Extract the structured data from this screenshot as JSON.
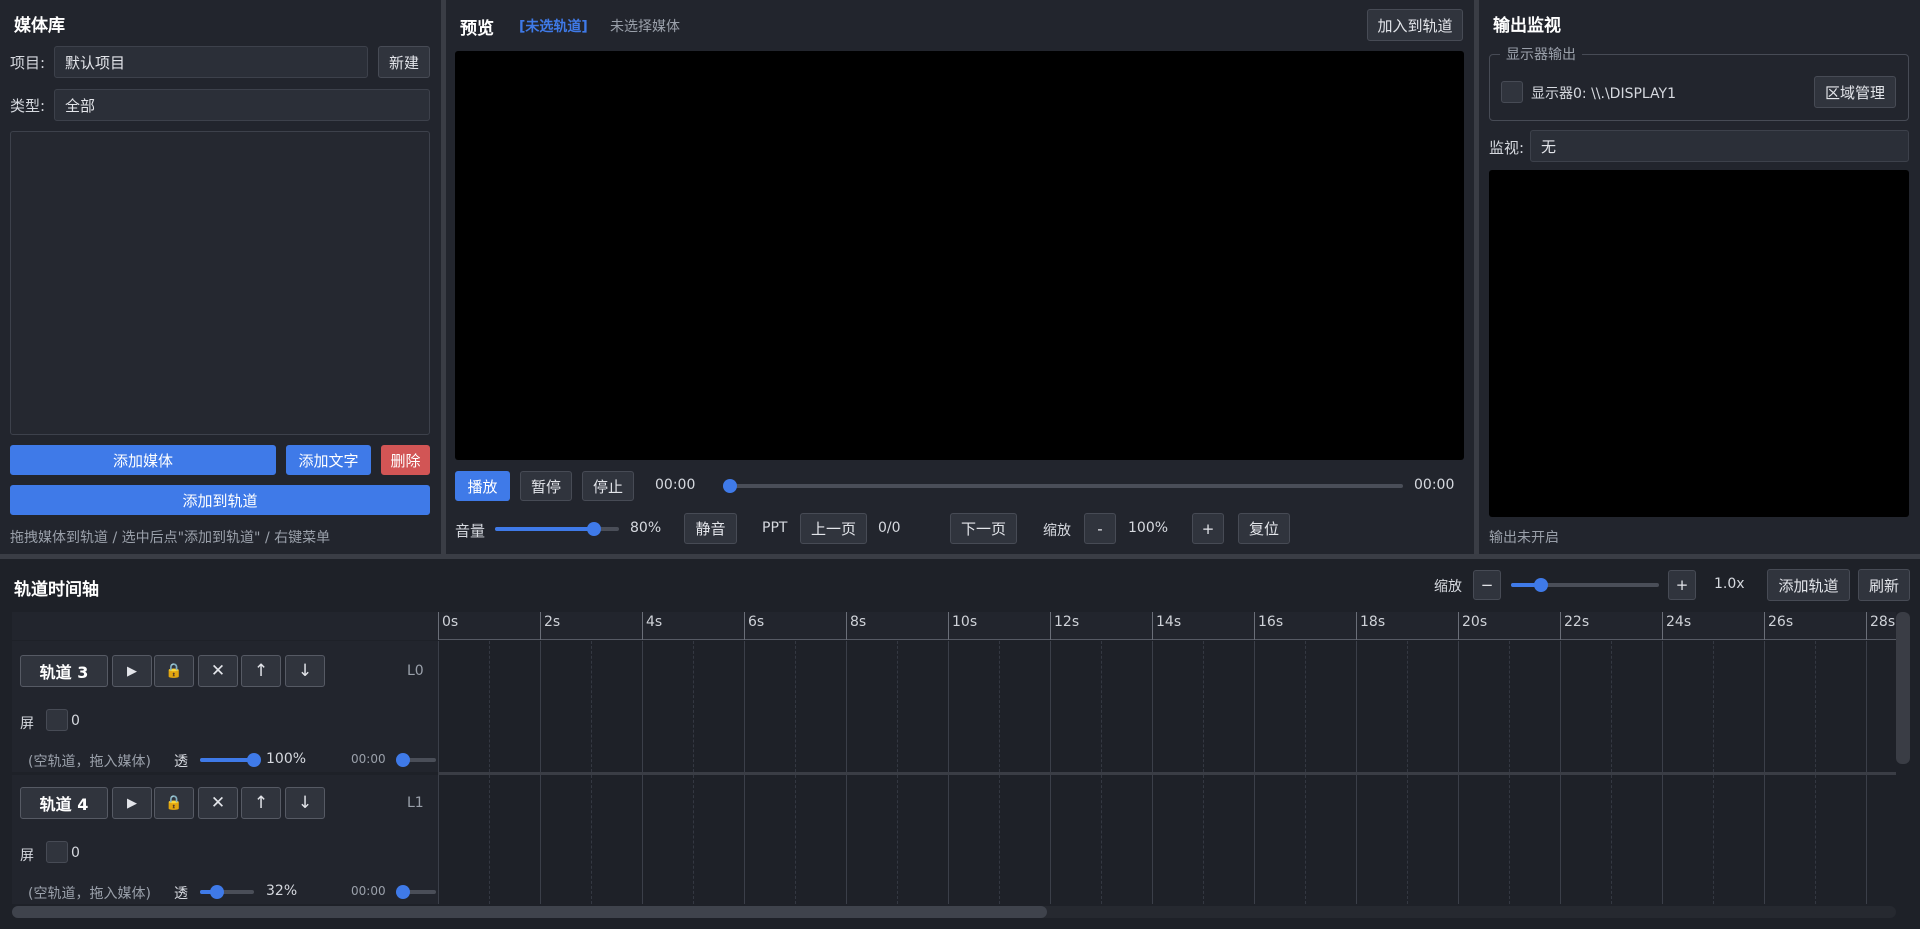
{
  "media": {
    "title": "媒体库",
    "project_label": "项目:",
    "project_value": "默认项目",
    "new_label": "新建",
    "type_label": "类型:",
    "type_value": "全部",
    "add_media_label": "添加媒体",
    "add_text_label": "添加文字",
    "delete_label": "删除",
    "add_to_track_label": "添加到轨道",
    "hint": "拖拽媒体到轨道 / 选中后点\"添加到轨道\" / 右键菜单"
  },
  "preview": {
    "title": "预览",
    "track_tag": "[未选轨道]",
    "media_status": "未选择媒体",
    "join_track_label": "加入到轨道",
    "play_label": "播放",
    "pause_label": "暂停",
    "stop_label": "停止",
    "time_current": "00:00",
    "time_total": "00:00",
    "progress": 0,
    "volume_label": "音量",
    "volume_value": "80%",
    "volume_level": 0.8,
    "mute_label": "静音",
    "ppt_label": "PPT",
    "prev_page_label": "上一页",
    "page_counter": "0/0",
    "next_page_label": "下一页",
    "zoom_label": "缩放",
    "zoom_minus": "-",
    "zoom_value": "100%",
    "zoom_plus": "+",
    "reset_label": "复位"
  },
  "output": {
    "title": "输出监视",
    "display_group_label": "显示器输出",
    "display_name": "显示器0: \\\\.\\DISPLAY1",
    "region_label": "区域管理",
    "monitor_label": "监视:",
    "monitor_value": "无",
    "status": "输出未开启"
  },
  "timeline": {
    "title": "轨道时间轴",
    "zoom_label": "缩放",
    "zoom_minus": "−",
    "zoom_plus": "+",
    "zoom_value": "1.0x",
    "zoom_level": 0.2,
    "add_track_label": "添加轨道",
    "refresh_label": "刷新",
    "ruler_labels": [
      "0s",
      "2s",
      "4s",
      "6s",
      "8s",
      "10s",
      "12s",
      "14s",
      "16s",
      "18s",
      "20s",
      "22s",
      "24s",
      "26s",
      "28s"
    ],
    "tracks": [
      {
        "name": "轨道 3",
        "layer": "L0",
        "screen_label": "屏",
        "screen_value": "0",
        "empty_hint": "(空轨道，拖入媒体)",
        "opacity_label": "透",
        "opacity_value": "100%",
        "opacity_level": 1.0,
        "time": "00:00",
        "play_icon": "▶",
        "lock_icon": "🔒",
        "remove_icon": "✕",
        "up_icon": "↑",
        "down_icon": "↓"
      },
      {
        "name": "轨道 4",
        "layer": "L1",
        "screen_label": "屏",
        "screen_value": "0",
        "empty_hint": "(空轨道，拖入媒体)",
        "opacity_label": "透",
        "opacity_value": "32%",
        "opacity_level": 0.32,
        "time": "00:00",
        "play_icon": "▶",
        "lock_icon": "🔒",
        "remove_icon": "✕",
        "up_icon": "↑",
        "down_icon": "↓"
      }
    ]
  },
  "colors": {
    "accent": "#3f7ae8",
    "danger": "#d25555",
    "background": "#22252d"
  }
}
